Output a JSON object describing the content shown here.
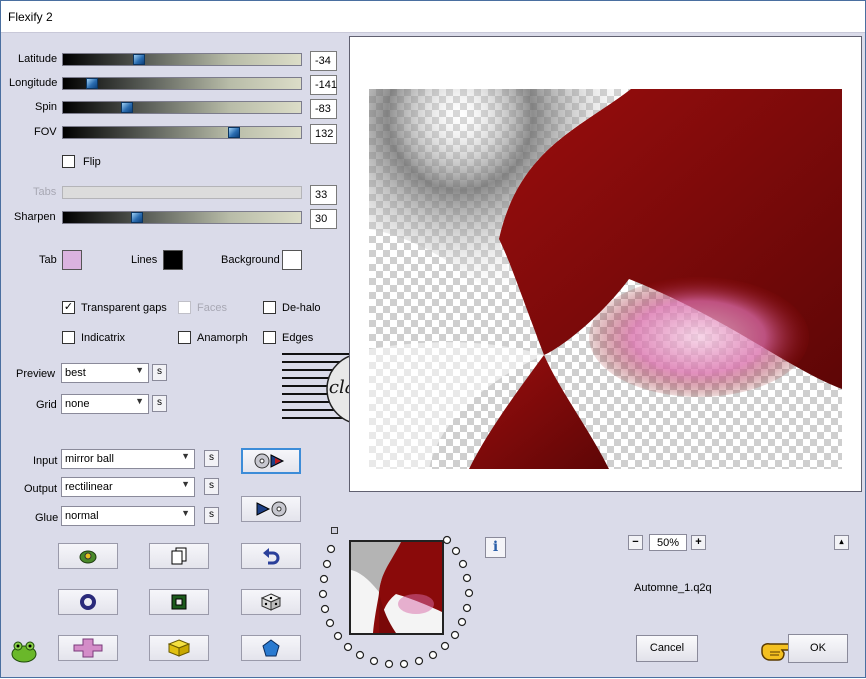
{
  "window": {
    "title": "Flexify 2"
  },
  "sliders": [
    {
      "label": "Latitude",
      "value": "-34",
      "position": 0.32,
      "enabled": true
    },
    {
      "label": "Longitude",
      "value": "-141",
      "position": 0.12,
      "enabled": true
    },
    {
      "label": "Spin",
      "value": "-83",
      "position": 0.27,
      "enabled": true
    },
    {
      "label": "FOV",
      "value": "132",
      "position": 0.72,
      "enabled": true
    },
    {
      "label": "Tabs",
      "value": "33",
      "position": null,
      "enabled": false
    },
    {
      "label": "Sharpen",
      "value": "30",
      "position": 0.31,
      "enabled": true
    }
  ],
  "flip": {
    "label": "Flip",
    "checked": false
  },
  "colors": {
    "tab": {
      "label": "Tab",
      "color": "#dbb3df"
    },
    "lines": {
      "label": "Lines",
      "color": "#000000"
    },
    "background": {
      "label": "Background",
      "color": "#ffffff"
    }
  },
  "options": {
    "transparent_gaps": {
      "label": "Transparent gaps",
      "checked": true,
      "enabled": true
    },
    "faces": {
      "label": "Faces",
      "checked": false,
      "enabled": false
    },
    "de_halo": {
      "label": "De-halo",
      "checked": false,
      "enabled": true
    },
    "indicatrix": {
      "label": "Indicatrix",
      "checked": false,
      "enabled": true
    },
    "anamorph": {
      "label": "Anamorph",
      "checked": false,
      "enabled": true
    },
    "edges": {
      "label": "Edges",
      "checked": false,
      "enabled": true
    }
  },
  "dropdowns": {
    "preview": {
      "label": "Preview",
      "value": "best"
    },
    "grid": {
      "label": "Grid",
      "value": "none"
    },
    "input": {
      "label": "Input",
      "value": "mirror ball"
    },
    "output": {
      "label": "Output",
      "value": "rectilinear"
    },
    "glue": {
      "label": "Glue",
      "value": "normal"
    }
  },
  "s_button_label": "s",
  "zoom": {
    "minus": "−",
    "value": "50%",
    "plus": "+",
    "expand": "▴"
  },
  "filename": "Automne_1.q2q",
  "buttons": {
    "cancel": "Cancel",
    "ok": "OK"
  },
  "info_label": "i",
  "watermark_text": "claudia",
  "accent_colors": {
    "slider_thumb": "#2a6cb0",
    "preview_red": "#8a0a0a",
    "pink": "#d86aa8"
  }
}
